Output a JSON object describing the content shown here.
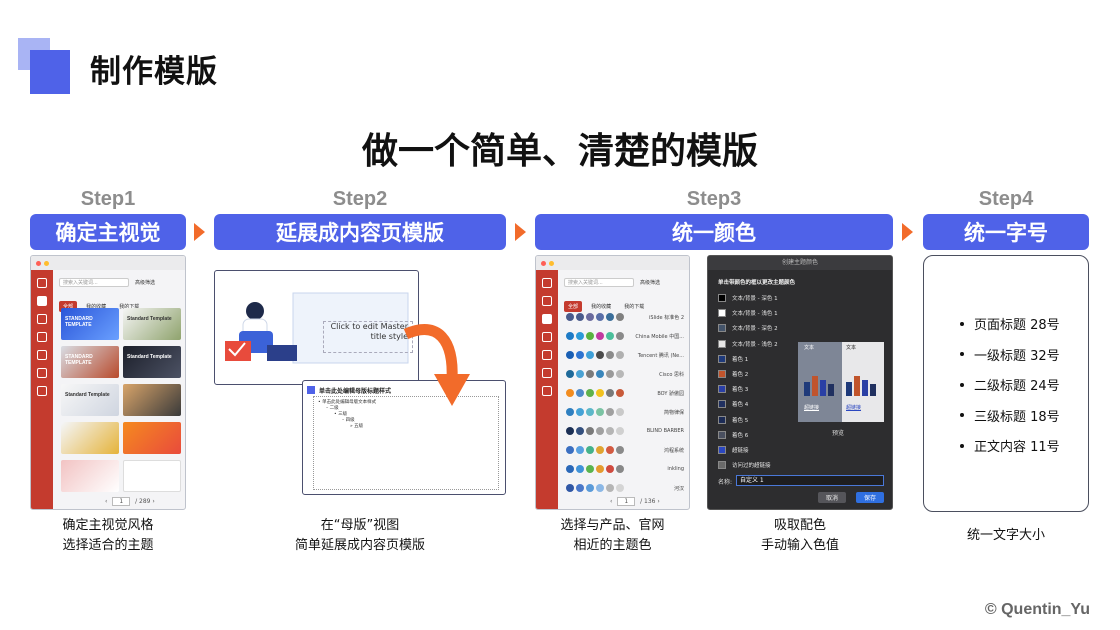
{
  "header": {
    "title": "制作模版"
  },
  "main_title": "做一个简单、清楚的模版",
  "steps": [
    {
      "label": "Step1",
      "title": "确定主视觉",
      "caption_lines": [
        "确定主视觉风格",
        "选择适合的主题"
      ]
    },
    {
      "label": "Step2",
      "title": "延展成内容页模版",
      "caption_lines": [
        "在“母版”视图",
        "简单延展成内容页模版"
      ]
    },
    {
      "label": "Step3",
      "title": "统一颜色",
      "caption_lines": [
        "选择与产品、官网",
        "相近的主题色"
      ],
      "caption_lines_2": [
        "吸取配色",
        "手动输入色值"
      ]
    },
    {
      "label": "Step4",
      "title": "统一字号",
      "caption_lines": [
        "统一文字大小"
      ]
    }
  ],
  "theme_browser": {
    "search_placeholder": "搜索入关键词...",
    "filter_label": "高级筛选",
    "tabs": [
      "全部",
      "我的收藏",
      "我的下载"
    ],
    "pagination": {
      "prev": "‹",
      "page": "1",
      "total": "/ 289",
      "next": "›"
    },
    "thumbs": [
      "STANDARD TEMPLATE",
      "Standard Template",
      "STANDARD TEMPLATE",
      "Standard Template",
      "Standard Template",
      "",
      "",
      "",
      "",
      ""
    ]
  },
  "master_view": {
    "slide_text": "Click to edit Master title style",
    "content_title": "单击此处编辑母版标题样式",
    "content_lines": [
      "• 单击此处编辑母版文本样式",
      "– 二级",
      "• 三级",
      "– 四级",
      "» 五级"
    ]
  },
  "color_browser": {
    "search_placeholder": "搜索入关键词...",
    "filter_label": "高级筛选",
    "tabs": [
      "全部",
      "我的收藏",
      "我的下载"
    ],
    "pagination": {
      "prev": "‹",
      "page": "1",
      "total": "/ 136",
      "next": "›"
    },
    "themes": [
      {
        "name": "iSlide 标准色 2",
        "colors": [
          "#4a5b8c",
          "#4a5b8c",
          "#6b6b9e",
          "#5a6fa8",
          "#3a6e9a",
          "#808080"
        ]
      },
      {
        "name": "China Mobile 中国...",
        "colors": [
          "#1e7bc6",
          "#2c9ad8",
          "#5ab23f",
          "#c23aa0",
          "#4bbf9b",
          "#8a8a8a"
        ]
      },
      {
        "name": "Tencent 腾讯 (Ne...",
        "colors": [
          "#1a5fb4",
          "#2f74d0",
          "#3fa0d8",
          "#4b4b4b",
          "#8b8b8b",
          "#b0b0b0"
        ]
      },
      {
        "name": "Cisco 思科",
        "colors": [
          "#1f6a9a",
          "#4aa2d3",
          "#7b7b7b",
          "#3a86bb",
          "#9a9a9a",
          "#b8b8b8"
        ]
      },
      {
        "name": "BOY 骄傲园",
        "colors": [
          "#f28c1f",
          "#4e8ac8",
          "#5fb14c",
          "#f2c21f",
          "#7a7a7a",
          "#c85a3a"
        ]
      },
      {
        "name": "简物律保",
        "colors": [
          "#2f7fc0",
          "#45a2d6",
          "#5cb7c9",
          "#7bc3a3",
          "#a0a0a0",
          "#c9c9c9"
        ]
      },
      {
        "name": "BLIND BARBER",
        "colors": [
          "#1b2f55",
          "#334f7e",
          "#7a7a7a",
          "#a0a0a0",
          "#b5b5b5",
          "#d0d0d0"
        ]
      },
      {
        "name": "鸿程系统",
        "colors": [
          "#3b6fc1",
          "#58a0e0",
          "#45b28b",
          "#e0a431",
          "#d35a41",
          "#8a8a8a"
        ]
      },
      {
        "name": "inkling",
        "colors": [
          "#2a68b8",
          "#4193d8",
          "#5ab44f",
          "#e59b2f",
          "#d04a3f",
          "#888888"
        ]
      },
      {
        "name": "河汉",
        "colors": [
          "#3057a5",
          "#4a78c9",
          "#5b9bd9",
          "#8cb8e6",
          "#b5b5b5",
          "#d5d5d5"
        ]
      }
    ]
  },
  "color_dialog": {
    "title": "创建主题颜色",
    "subtitle": "单击带颜色的框以更改主题颜色",
    "rows": [
      {
        "label": "文本/背景 - 深色 1",
        "color": "#000000"
      },
      {
        "label": "文本/背景 - 浅色 1",
        "color": "#ffffff"
      },
      {
        "label": "文本/背景 - 深色 2",
        "color": "#44546a"
      },
      {
        "label": "文本/背景 - 浅色 2",
        "color": "#e7e6e6"
      },
      {
        "label": "着色 1",
        "color": "#1f3a7a"
      },
      {
        "label": "着色 2",
        "color": "#c0542c"
      },
      {
        "label": "着色 3",
        "color": "#2a3fa5"
      },
      {
        "label": "着色 4",
        "color": "#203060"
      },
      {
        "label": "着色 5",
        "color": "#1c2b55"
      },
      {
        "label": "着色 6",
        "color": "#4a5060"
      },
      {
        "label": "超链接",
        "color": "#2b47c0"
      },
      {
        "label": "访问过的超链接",
        "color": "#6a6a6a"
      }
    ],
    "preview_text_a": "文本",
    "preview_text_b": "文本",
    "preview_link_a": "超链接",
    "preview_link_b": "超链接",
    "preview_label": "预览",
    "name_label": "名称:",
    "name_value": "自定义 1",
    "cancel": "取消",
    "save": "保存"
  },
  "font_sizes": [
    "页面标题 28号",
    "一级标题 32号",
    "二级标题 24号",
    "三级标题 18号",
    "正文内容 11号"
  ],
  "credit": "© Quentin_Yu",
  "colors": {
    "accent": "#4f62e8",
    "arrow": "#f26b2a",
    "theme_red": "#c43b2e"
  }
}
